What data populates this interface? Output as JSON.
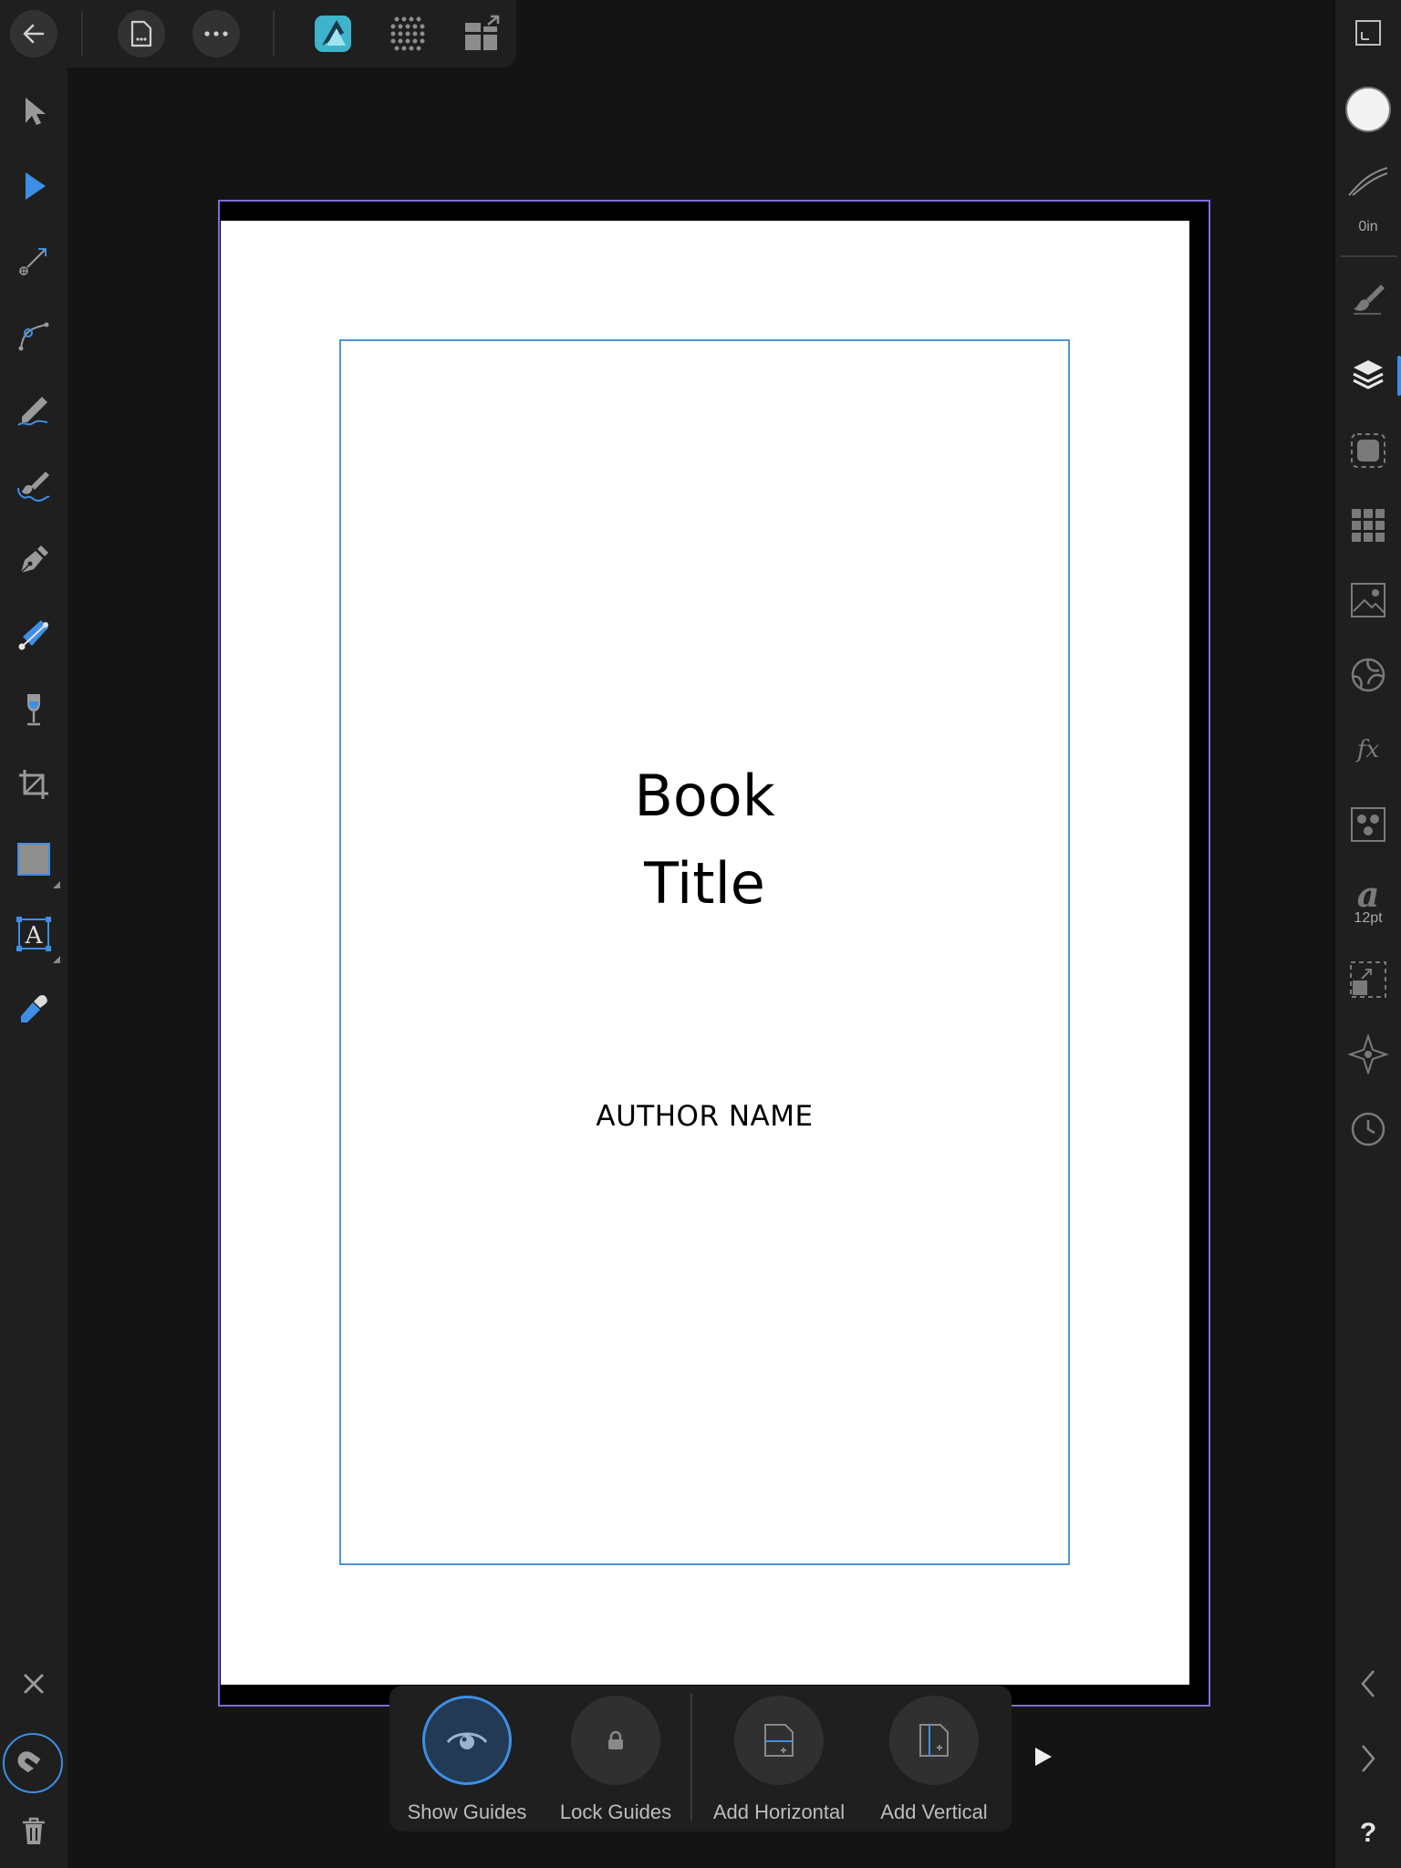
{
  "document": {
    "title_line1": "Book",
    "title_line2": "Title",
    "author": "AUTHOR NAME"
  },
  "studio": {
    "stroke_width": "0in",
    "font_size": "12pt"
  },
  "guides_toolbar": {
    "show_guides": "Show Guides",
    "lock_guides": "Lock Guides",
    "add_horizontal": "Add Horizontal",
    "add_vertical": "Add Vertical"
  },
  "help": {
    "label": "?"
  },
  "colors": {
    "accent": "#3d8fe6",
    "bleed_border": "#7d6ed8",
    "panel": "#1f1f1f",
    "background": "#141414"
  }
}
